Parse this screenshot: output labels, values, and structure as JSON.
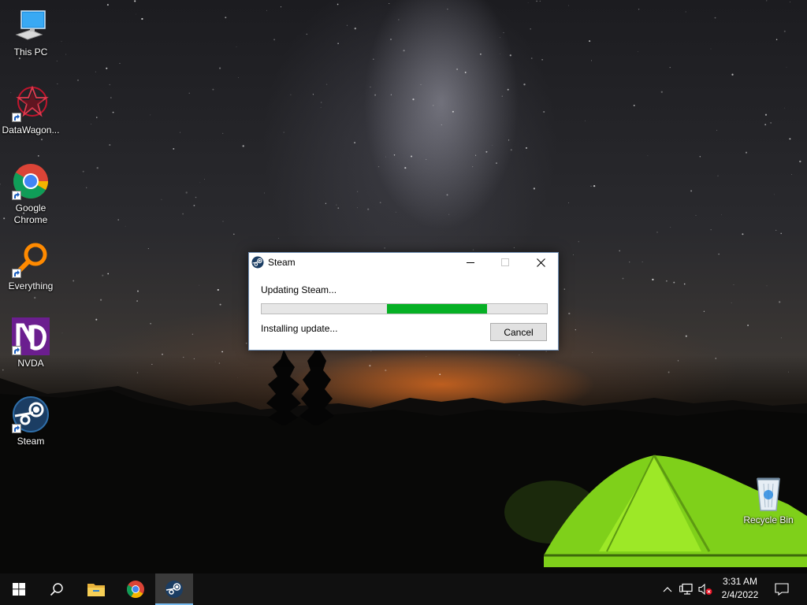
{
  "desktop": {
    "icons": [
      {
        "label": "This PC",
        "icon": "computer-icon"
      },
      {
        "label": "DataWagon...",
        "icon": "datawagon-icon"
      },
      {
        "label": "Google\nChrome",
        "icon": "chrome-icon"
      },
      {
        "label": "Everything",
        "icon": "everything-search-icon"
      },
      {
        "label": "NVDA",
        "icon": "nvda-icon"
      },
      {
        "label": "Steam",
        "icon": "steam-icon"
      },
      {
        "label": "Recycle Bin",
        "icon": "recycle-bin-icon"
      }
    ]
  },
  "dialog": {
    "title": "Steam",
    "heading": "Updating Steam...",
    "status": "Installing update...",
    "cancel_label": "Cancel",
    "progress": {
      "style": "marquee",
      "segment_start": 0.44,
      "segment_end": 0.79,
      "color": "#06b025"
    }
  },
  "taskbar": {
    "items": [
      "start-icon",
      "search-icon",
      "file-explorer-icon",
      "chrome-icon",
      "steam-icon"
    ],
    "active_item": "steam-icon",
    "accent": "#76b9ed",
    "tray": {
      "time": "3:31 AM",
      "date": "2/4/2022"
    }
  }
}
